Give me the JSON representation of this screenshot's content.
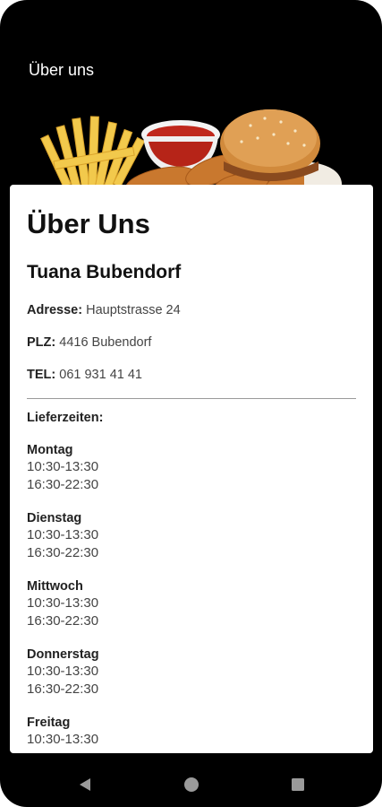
{
  "appbar": {
    "title": "Über uns"
  },
  "page": {
    "title": "Über Uns"
  },
  "shop": {
    "name": "Tuana Bubendorf",
    "address_label": "Adresse:",
    "address_value": "Hauptstrasse 24",
    "plz_label": "PLZ:",
    "plz_value": "4416 Bubendorf",
    "tel_label": "TEL:",
    "tel_value": "061 931 41 41"
  },
  "hours": {
    "heading": "Lieferzeiten:",
    "days": [
      {
        "name": "Montag",
        "slots": [
          "10:30-13:30",
          "16:30-22:30"
        ]
      },
      {
        "name": "Dienstag",
        "slots": [
          "10:30-13:30",
          "16:30-22:30"
        ]
      },
      {
        "name": "Mittwoch",
        "slots": [
          "10:30-13:30",
          "16:30-22:30"
        ]
      },
      {
        "name": "Donnerstag",
        "slots": [
          "10:30-13:30",
          "16:30-22:30"
        ]
      },
      {
        "name": "Freitag",
        "slots": [
          "10:30-13:30"
        ]
      }
    ]
  },
  "navbar": {
    "icons": [
      "back-icon",
      "home-icon",
      "recents-icon"
    ]
  },
  "colors": {
    "background": "#000000",
    "card": "#ffffff",
    "text": "#222222"
  }
}
